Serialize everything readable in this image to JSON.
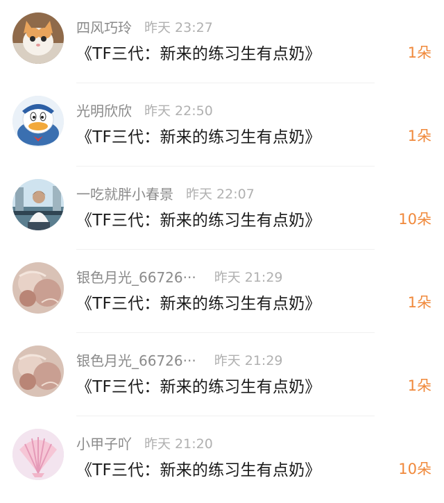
{
  "gift_list": {
    "items": [
      {
        "username": "四风巧玲",
        "time": "昨天 23:27",
        "title": "《TF三代：新来的练习生有点奶》",
        "count": "1朵",
        "avatar_icon": "cat-avatar-icon"
      },
      {
        "username": "光明欣欣",
        "time": "昨天 22:50",
        "title": "《TF三代：新来的练习生有点奶》",
        "count": "1朵",
        "avatar_icon": "donald-duck-avatar-icon"
      },
      {
        "username": "一吃就胖小春景",
        "time": "昨天 22:07",
        "title": "《TF三代：新来的练习生有点奶》",
        "count": "10朵",
        "avatar_icon": "person-photo-avatar-icon"
      },
      {
        "username": "银色月光_66726···",
        "time": "昨天 21:29",
        "title": "《TF三代：新来的练习生有点奶》",
        "count": "1朵",
        "avatar_icon": "pink-photo-avatar-icon"
      },
      {
        "username": "银色月光_66726···",
        "time": "昨天 21:29",
        "title": "《TF三代：新来的练习生有点奶》",
        "count": "1朵",
        "avatar_icon": "pink-photo-avatar-icon"
      },
      {
        "username": "小甲子吖",
        "time": "昨天 21:20",
        "title": "《TF三代：新来的练习生有点奶》",
        "count": "10朵",
        "avatar_icon": "seashell-avatar-icon"
      }
    ]
  },
  "colors": {
    "count_accent": "#f0883a",
    "username": "#8a8a8a",
    "time": "#b0b0b0",
    "title": "#1a1a1a"
  }
}
